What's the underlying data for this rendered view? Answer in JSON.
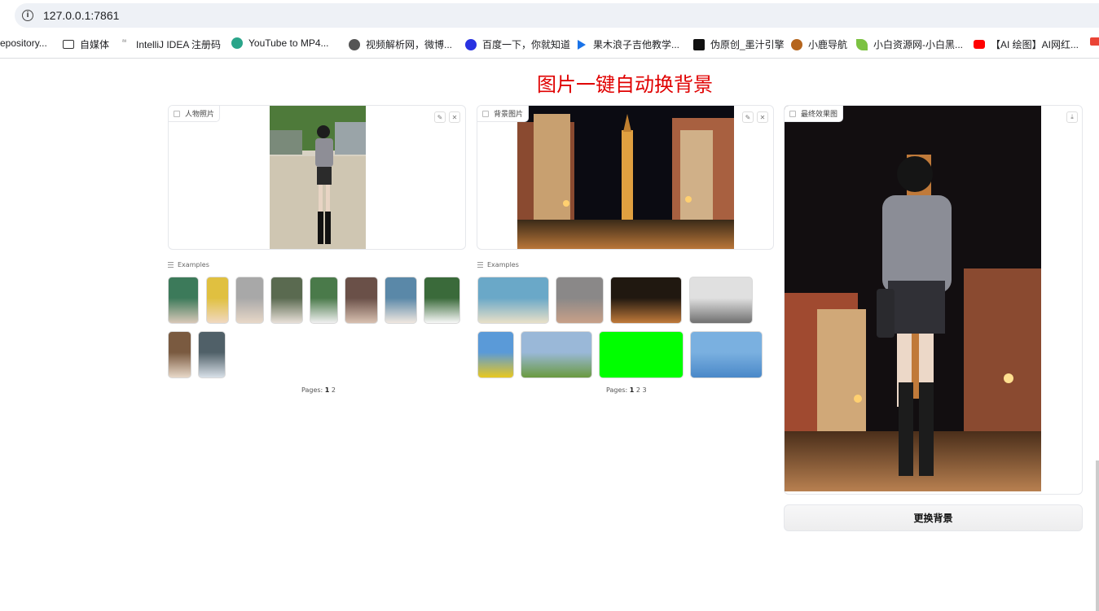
{
  "browser": {
    "url": "127.0.0.1:7861",
    "bookmarks": [
      {
        "label": "epository...",
        "icon": "none"
      },
      {
        "label": "自媒体",
        "icon": "folder-icon"
      },
      {
        "label": "IntelliJ IDEA 注册码",
        "icon": "intellij-icon"
      },
      {
        "label": "YouTube to MP4...",
        "icon": "youtube-mp4-icon"
      },
      {
        "label": "视频解析网，微博...",
        "icon": "globe-icon"
      },
      {
        "label": "百度一下，你就知道",
        "icon": "baidu-icon"
      },
      {
        "label": "果木浪子吉他教学...",
        "icon": "arrow-icon"
      },
      {
        "label": "伪原创_墨汁引擎",
        "icon": "moz-icon"
      },
      {
        "label": "小鹿导航",
        "icon": "deer-icon"
      },
      {
        "label": "小白资源网-小白黑...",
        "icon": "leaf-icon"
      },
      {
        "label": "【AI 绘图】AI网红...",
        "icon": "youtube-icon"
      }
    ]
  },
  "page": {
    "title": "图片一键自动换背景",
    "person_panel": {
      "label": "人物照片",
      "edit_icon": "pencil-icon",
      "clear_icon": "close-icon"
    },
    "background_panel": {
      "label": "背景图片",
      "edit_icon": "pencil-icon",
      "clear_icon": "close-icon"
    },
    "result_panel": {
      "label": "最终效果图",
      "download_icon": "download-icon"
    },
    "person_examples": {
      "heading": "Examples",
      "pages_label": "Pages:",
      "pages": [
        "1",
        "2"
      ],
      "current_page": "1"
    },
    "background_examples": {
      "heading": "Examples",
      "pages_label": "Pages:",
      "pages": [
        "1",
        "2",
        "3"
      ],
      "current_page": "1"
    },
    "action_button": "更换背景"
  }
}
